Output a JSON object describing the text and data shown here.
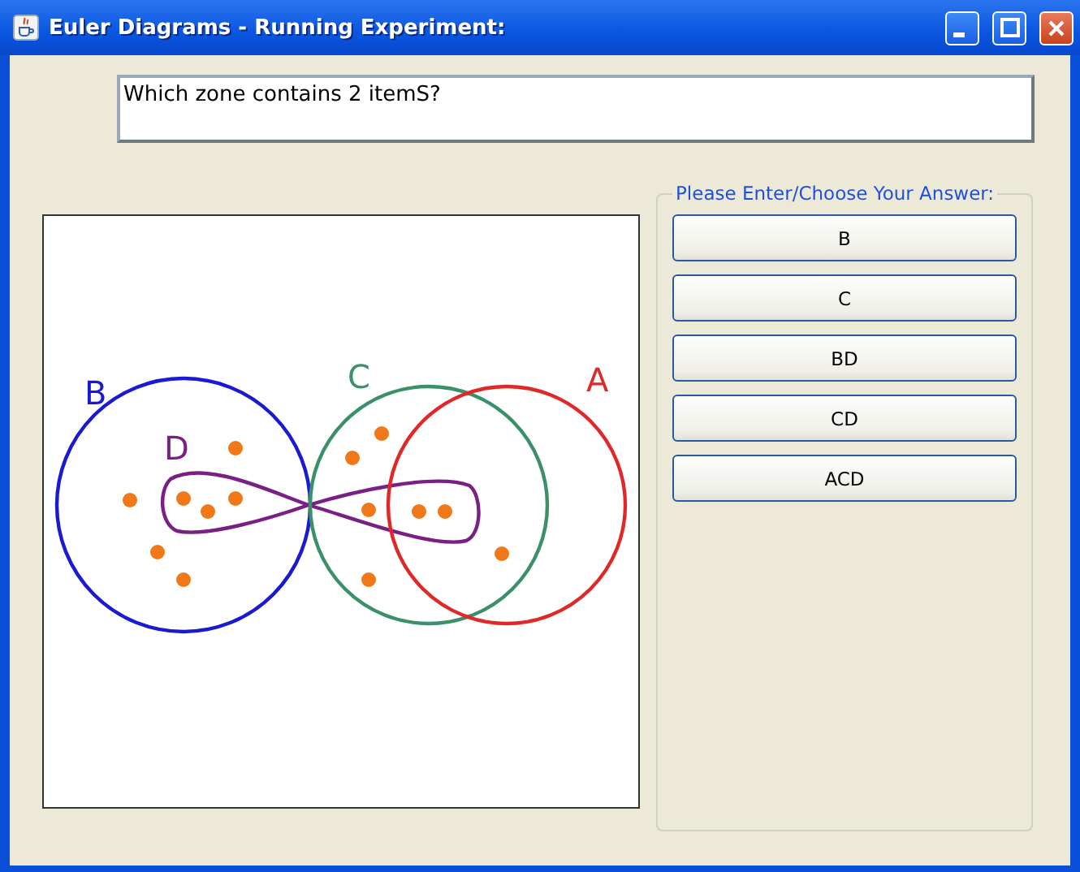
{
  "window": {
    "title": "Euler Diagrams - Running Experiment:"
  },
  "question": {
    "value": "Which zone contains 2 itemS?"
  },
  "diagram": {
    "sets": [
      {
        "label": "B",
        "color": "#1a1ad0",
        "kind": "circle"
      },
      {
        "label": "D",
        "color": "#7a1f85",
        "kind": "loop"
      },
      {
        "label": "C",
        "color": "#3a9068",
        "kind": "circle"
      },
      {
        "label": "A",
        "color": "#e02828",
        "kind": "circle"
      }
    ]
  },
  "answers": {
    "title": "Please Enter/Choose Your Answer:",
    "options": [
      "B",
      "C",
      "BD",
      "CD",
      "ACD"
    ]
  }
}
